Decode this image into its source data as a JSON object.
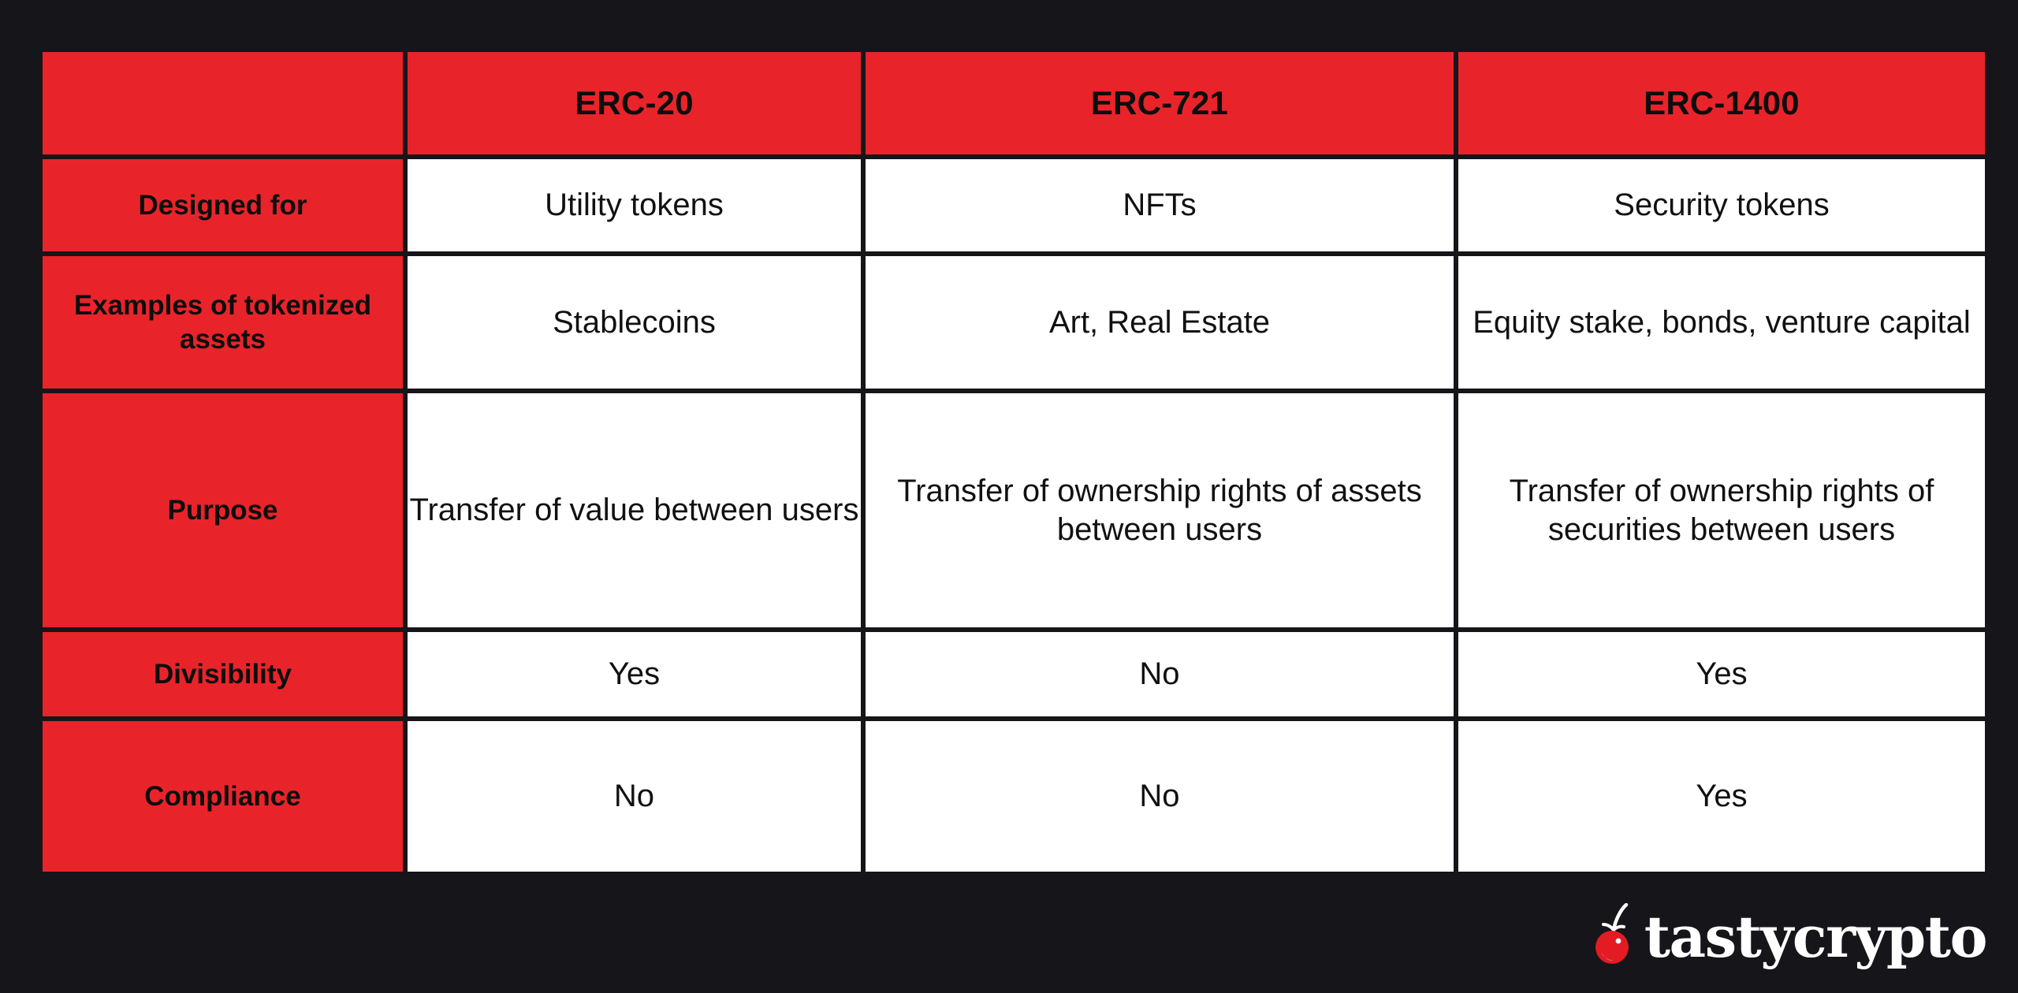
{
  "theme": {
    "background": "#16151A",
    "accent_red": "#E8242A",
    "cell_background": "#FFFFFF",
    "text_dark": "#111111",
    "text_light": "#FFFFFF"
  },
  "table": {
    "corner_label": "",
    "columns": [
      "ERC-20",
      "ERC-721",
      "ERC-1400"
    ],
    "rows": [
      {
        "label": "Designed for",
        "values": [
          "Utility tokens",
          "NFTs",
          "Security tokens"
        ]
      },
      {
        "label": "Examples of tokenized assets",
        "values": [
          "Stablecoins",
          "Art, Real Estate",
          "Equity stake, bonds, venture capital"
        ]
      },
      {
        "label": "Purpose",
        "values": [
          "Transfer of value between users",
          "Transfer of ownership rights of assets between users",
          "Transfer of ownership rights of securities between users"
        ]
      },
      {
        "label": "Divisibility",
        "values": [
          "Yes",
          "No",
          "Yes"
        ]
      },
      {
        "label": "Compliance",
        "values": [
          "No",
          "No",
          "Yes"
        ]
      }
    ]
  },
  "branding": {
    "wordmark": "tastycrypto",
    "icon": "cherry-icon",
    "icon_color": "#E31B23",
    "stem_color": "#FFFFFF"
  }
}
